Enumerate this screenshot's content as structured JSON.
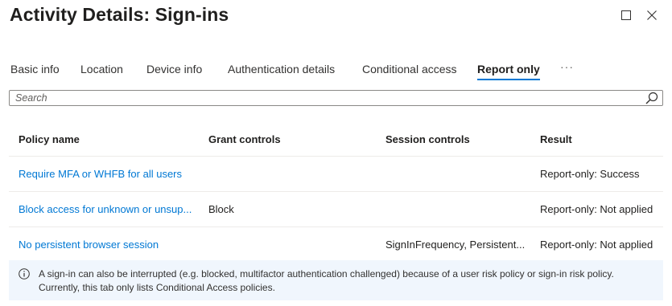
{
  "window": {
    "title": "Activity Details: Sign-ins"
  },
  "tabs": [
    {
      "label": "Basic info",
      "active": false
    },
    {
      "label": "Location",
      "active": false
    },
    {
      "label": "Device info",
      "active": false
    },
    {
      "label": "Authentication details",
      "active": false
    },
    {
      "label": "Conditional access",
      "active": false
    },
    {
      "label": "Report only",
      "active": true
    }
  ],
  "more_tabs_label": "···",
  "search": {
    "placeholder": "Search"
  },
  "table": {
    "columns": [
      "Policy name",
      "Grant controls",
      "Session controls",
      "Result"
    ],
    "rows": [
      [
        "Require MFA or WHFB for all users",
        "",
        "",
        "Report-only: Success"
      ],
      [
        "Block access for unknown or unsup...",
        "Block",
        "",
        "Report-only: Not applied"
      ],
      [
        "No persistent browser session",
        "",
        "SignInFrequency, Persistent...",
        "Report-only: Not applied"
      ]
    ]
  },
  "info_banner": {
    "line1": "A sign-in can also be interrupted (e.g. blocked, multifactor authentication challenged) because of a user risk policy or sign-in risk policy.",
    "line2": "Currently, this tab only lists Conditional Access policies."
  },
  "colors": {
    "accent": "#0078d4",
    "info_background": "#f0f6fd"
  },
  "icons": {
    "maximize": "maximize-icon",
    "close": "close-icon",
    "search": "search-icon",
    "info": "info-icon"
  }
}
